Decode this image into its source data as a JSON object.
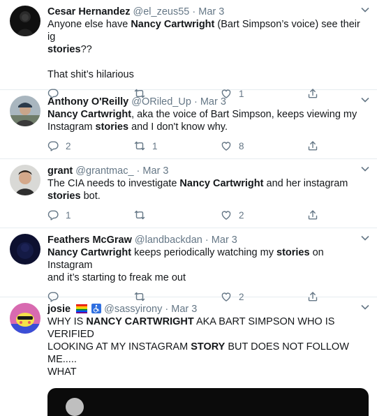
{
  "tweets": [
    {
      "name": "Cesar Hernandez",
      "handle": "@el_zeus55",
      "dot": "·",
      "date": "Mar 3",
      "body_line1_pre": "Anyone else have ",
      "body_line1_bold": "Nancy Cartwright",
      "body_line1_post": " (Bart Simpson’s voice) see their ig",
      "body_line2_bold": "stories",
      "body_line2_post": "??",
      "body_line3": "That shit’s hilarious",
      "replies": "",
      "retweets": "",
      "likes": "1"
    },
    {
      "name": "Anthony O'Reilly",
      "handle": "@ORiled_Up",
      "dot": "·",
      "date": "Mar 3",
      "body_line1_bold": "Nancy Cartwright",
      "body_line1_post": ", aka the voice of Bart Simpson, keeps viewing my",
      "body_line2_pre": "Instagram ",
      "body_line2_bold": "stories",
      "body_line2_post": " and I don't know why.",
      "replies": "2",
      "retweets": "1",
      "likes": "8"
    },
    {
      "name": "grant",
      "handle": "@grantmac_",
      "dot": "·",
      "date": "Mar 3",
      "body_line1_pre": "The CIA needs to investigate ",
      "body_line1_bold": "Nancy Cartwright",
      "body_line1_post": " and her instagram",
      "body_line2_bold": "stories",
      "body_line2_post": " bot.",
      "replies": "1",
      "retweets": "",
      "likes": "2"
    },
    {
      "name": "Feathers McGraw",
      "handle": "@landbackdan",
      "dot": "·",
      "date": "Mar 3",
      "body_line1_bold": "Nancy Cartwright",
      "body_line1_mid": " keeps periodically watching my ",
      "body_line1_bold2": "stories",
      "body_line1_post": " on Instagram",
      "body_line2": "and it’s starting to freak me out",
      "replies": "",
      "retweets": "",
      "likes": "2"
    },
    {
      "name": "josie",
      "handle": "@sassyirony",
      "dot": "·",
      "date": "Mar 3",
      "body_line1_pre": "WHY IS ",
      "body_line1_bold": "NANCY CARTWRIGHT",
      "body_line1_post": " AKA BART SIMPSON WHO IS VERIFIED",
      "body_line2_pre": "LOOKING AT MY INSTAGRAM ",
      "body_line2_bold": "STORY",
      "body_line2_post": " BUT DOES NOT FOLLOW ME.....",
      "body_line3": "WHAT"
    }
  ],
  "icons": {
    "reply": "reply-icon",
    "retweet": "retweet-icon",
    "like": "heart-icon",
    "share": "share-icon",
    "menu": "chevron-down-icon"
  },
  "colors": {
    "muted": "#657786",
    "text": "#14171a",
    "divider": "#e6ecf0"
  }
}
